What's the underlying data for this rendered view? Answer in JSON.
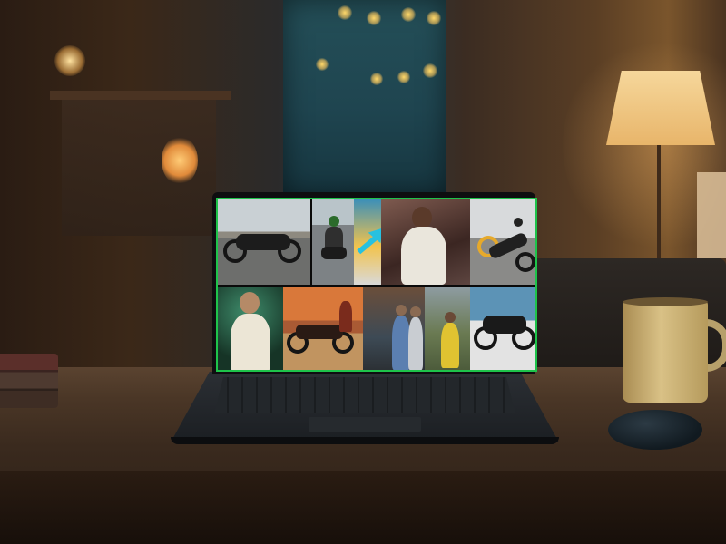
{
  "scene": {
    "description_tags": [
      "room-background",
      "window",
      "table-lamp",
      "desk",
      "coffee-mug",
      "computer-mouse",
      "laptop",
      "photo-collage"
    ]
  },
  "colors": {
    "screen_border": "#1ec34a",
    "lamp_light": "#f6d79b",
    "mug": "#d9c186",
    "desk": "#4a3626"
  },
  "laptop": {
    "screen": {
      "collage_tiles": [
        {
          "icon": "motorcycle-photo"
        },
        {
          "icon": "rider-photo"
        },
        {
          "icon": "arrow-photo"
        },
        {
          "icon": "portrait-photo"
        },
        {
          "icon": "wheelie-photo"
        },
        {
          "icon": "portrait-photo"
        },
        {
          "icon": "motorcycle-sunset-photo"
        },
        {
          "icon": "group-photo"
        },
        {
          "icon": "group-photo"
        },
        {
          "icon": "motorcycle-photo"
        }
      ]
    }
  }
}
